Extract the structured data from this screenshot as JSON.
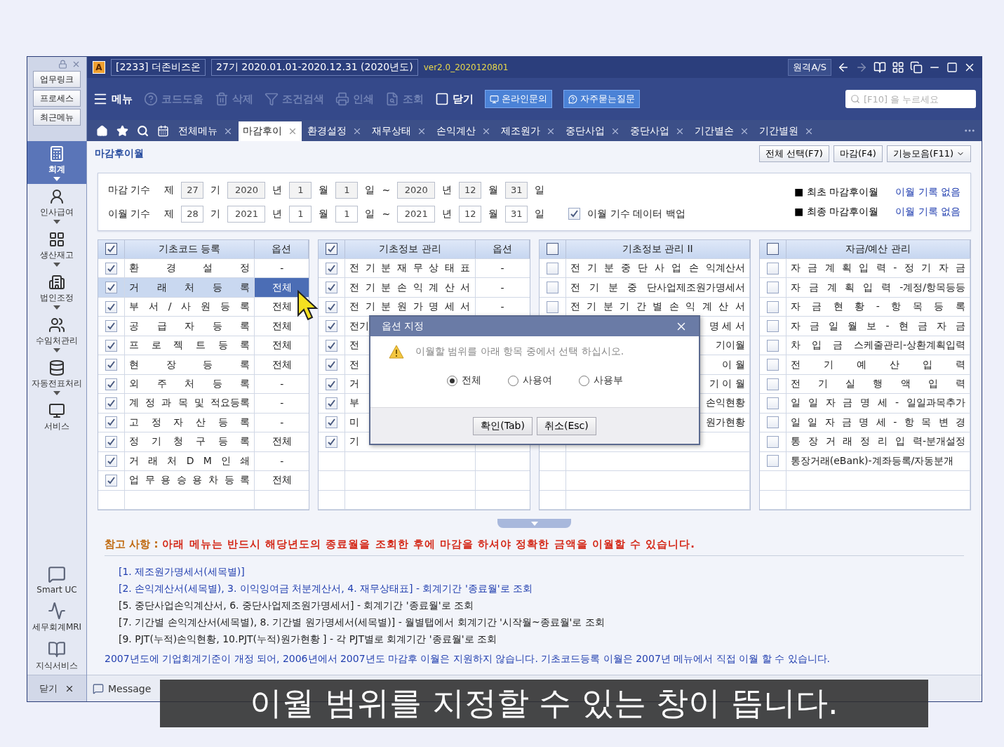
{
  "title_bar": {
    "logo": "A",
    "company": "[2233] 더존비즈온",
    "period": "27기 2020.01.01-2020.12.31 (2020년도)",
    "version": "ver2.0_2020120801",
    "remote": "원격A/S"
  },
  "sidebar": {
    "links": [
      "업무링크",
      "프로세스",
      "최근메뉴"
    ],
    "modules": [
      {
        "label": "회계",
        "selected": true,
        "expandable": true
      },
      {
        "label": "인사급여",
        "selected": false,
        "expandable": true
      },
      {
        "label": "생산재고",
        "selected": false,
        "expandable": true
      },
      {
        "label": "법인조정",
        "selected": false,
        "expandable": true
      },
      {
        "label": "수임처관리",
        "selected": false,
        "expandable": true
      },
      {
        "label": "자동전표처리",
        "selected": false,
        "expandable": true
      },
      {
        "label": "서비스",
        "selected": false,
        "expandable": false
      }
    ],
    "services": [
      "Smart UC",
      "세무회계MRI",
      "지식서비스"
    ],
    "close": "닫기"
  },
  "toolbar": {
    "menu": "메뉴",
    "actions": [
      {
        "label": "코드도움",
        "disabled": true
      },
      {
        "label": "삭제",
        "disabled": true
      },
      {
        "label": "조건검색",
        "disabled": true
      },
      {
        "label": "인쇄",
        "disabled": true
      },
      {
        "label": "조회",
        "disabled": true
      },
      {
        "label": "닫기",
        "disabled": false
      }
    ],
    "help": [
      "온라인문의",
      "자주묻는질문"
    ],
    "search": {
      "placeholder": "[F10] 을 누르세요"
    }
  },
  "tabs": [
    {
      "label": "전체메뉴",
      "selected": false
    },
    {
      "label": "마감후이",
      "selected": true
    },
    {
      "label": "환경설정",
      "selected": false
    },
    {
      "label": "재무상태",
      "selected": false
    },
    {
      "label": "손익계산",
      "selected": false
    },
    {
      "label": "제조원가",
      "selected": false
    },
    {
      "label": "중단사업",
      "selected": false
    },
    {
      "label": "중단사업",
      "selected": false
    },
    {
      "label": "기간별손",
      "selected": false
    },
    {
      "label": "기간별원",
      "selected": false
    }
  ],
  "page": {
    "title": "마감후이월",
    "buttons": [
      {
        "label": "전체 선택(F7)",
        "dropdown": false
      },
      {
        "label": "마감(F4)",
        "dropdown": false
      },
      {
        "label": "기능모음(F11)",
        "dropdown": true
      }
    ]
  },
  "form": {
    "rows": [
      {
        "label": "마감 기수",
        "disabled": true,
        "parts": [
          {
            "kind": "text",
            "text": "제"
          },
          {
            "kind": "field",
            "value": "27"
          },
          {
            "kind": "text",
            "text": "기"
          },
          {
            "kind": "field",
            "value": "2020",
            "wide": true
          },
          {
            "kind": "text",
            "text": "년"
          },
          {
            "kind": "field",
            "value": "1"
          },
          {
            "kind": "text",
            "text": "월"
          },
          {
            "kind": "field",
            "value": "1"
          },
          {
            "kind": "text",
            "text": "일"
          },
          {
            "kind": "text",
            "text": "~"
          },
          {
            "kind": "field",
            "value": "2020",
            "wide": true
          },
          {
            "kind": "text",
            "text": "년"
          },
          {
            "kind": "field",
            "value": "12"
          },
          {
            "kind": "text",
            "text": "월"
          },
          {
            "kind": "field",
            "value": "31"
          },
          {
            "kind": "text",
            "text": "일"
          }
        ]
      },
      {
        "label": "이월 기수",
        "disabled": false,
        "parts": [
          {
            "kind": "text",
            "text": "제"
          },
          {
            "kind": "field",
            "value": "28"
          },
          {
            "kind": "text",
            "text": "기"
          },
          {
            "kind": "field",
            "value": "2021",
            "wide": true
          },
          {
            "kind": "text",
            "text": "년"
          },
          {
            "kind": "field",
            "value": "1"
          },
          {
            "kind": "text",
            "text": "월"
          },
          {
            "kind": "field",
            "value": "1"
          },
          {
            "kind": "text",
            "text": "일"
          },
          {
            "kind": "text",
            "text": "~"
          },
          {
            "kind": "field",
            "value": "2021",
            "wide": true
          },
          {
            "kind": "text",
            "text": "년"
          },
          {
            "kind": "field",
            "value": "12"
          },
          {
            "kind": "text",
            "text": "월"
          },
          {
            "kind": "field",
            "value": "31"
          },
          {
            "kind": "text",
            "text": "일"
          }
        ],
        "backup": {
          "label": "이월 기수 데이터 백업",
          "checked": true
        }
      }
    ],
    "history": [
      {
        "label": "■ 최초 마감후이월",
        "value": "이월 기록 없음"
      },
      {
        "label": "■ 최종 마감후이월",
        "value": "이월 기록 없음"
      }
    ]
  },
  "tables": [
    {
      "title": "기초코드 등록",
      "option_title": "옵션",
      "checked": true,
      "rows": [
        {
          "kind": "full",
          "checked": true,
          "selected": false,
          "text": "환 경 설 정",
          "option": "-"
        },
        {
          "kind": "full",
          "checked": true,
          "selected": true,
          "text": "거 래 처 등 록",
          "option": "전체"
        },
        {
          "kind": "full",
          "checked": true,
          "selected": false,
          "text": "부 서 / 사 원 등 록",
          "option": "전체"
        },
        {
          "kind": "full",
          "checked": true,
          "selected": false,
          "text": "공 급 자 등 록",
          "option": "전체"
        },
        {
          "kind": "full",
          "checked": true,
          "selected": false,
          "text": "프 로 젝 트 등 록",
          "option": "전체"
        },
        {
          "kind": "full",
          "checked": true,
          "selected": false,
          "text": "현 장 등 록",
          "option": "전체"
        },
        {
          "kind": "full",
          "checked": true,
          "selected": false,
          "text": "외 주 처 등 록",
          "option": "-"
        },
        {
          "kind": "full",
          "checked": true,
          "selected": false,
          "text": "계 정 과 목 및 적요등록",
          "option": "-"
        },
        {
          "kind": "full",
          "checked": true,
          "selected": false,
          "text": "고 정 자 산 등 록",
          "option": "-"
        },
        {
          "kind": "full",
          "checked": true,
          "selected": false,
          "text": "정 기 청 구 등 록",
          "option": "전체"
        },
        {
          "kind": "full",
          "checked": true,
          "selected": false,
          "text": "거 래 처 D M 인 쇄",
          "option": "-"
        },
        {
          "kind": "full",
          "checked": true,
          "selected": false,
          "text": "업 무 용 승 용 차 등 록",
          "option": "전체"
        }
      ]
    },
    {
      "title": "기초정보 관리",
      "option_title": "옵션",
      "checked": true,
      "rows": [
        {
          "kind": "full",
          "checked": true,
          "selected": false,
          "text": "전 기 분 재 무 상 태 표",
          "option": "-"
        },
        {
          "kind": "full",
          "checked": true,
          "selected": false,
          "text": "전 기 분 손 익 계 산 서",
          "option": "-"
        },
        {
          "kind": "full",
          "checked": true,
          "selected": false,
          "text": "전 기 분 원 가 명 세 서",
          "option": "-"
        },
        {
          "kind": "head",
          "checked": true,
          "selected": false,
          "text": "전기"
        },
        {
          "kind": "head",
          "checked": true,
          "selected": false,
          "text": "전"
        },
        {
          "kind": "head",
          "checked": true,
          "selected": false,
          "text": "전"
        },
        {
          "kind": "head",
          "checked": true,
          "selected": false,
          "text": "거"
        },
        {
          "kind": "head",
          "checked": true,
          "selected": false,
          "text": "부"
        },
        {
          "kind": "head",
          "checked": true,
          "selected": false,
          "text": "미"
        },
        {
          "kind": "head",
          "checked": true,
          "selected": false,
          "text": "기"
        }
      ]
    },
    {
      "title": "기초정보 관리 II",
      "checked": false,
      "rows": [
        {
          "kind": "full",
          "checked": false,
          "selected": false,
          "text": "전 기 분 중 단 사 업 손 익계산서"
        },
        {
          "kind": "full",
          "checked": false,
          "selected": false,
          "text": "전 기 분 중 단사업제조원가명세서"
        },
        {
          "kind": "full",
          "checked": false,
          "selected": false,
          "text": "전 기 분 기 간 별 손 익 계 산 서"
        },
        {
          "kind": "tail",
          "selected": false,
          "text": "명 세 서"
        },
        {
          "kind": "tail",
          "selected": false,
          "text": "기이월"
        },
        {
          "kind": "tail",
          "selected": false,
          "text": "이 월"
        },
        {
          "kind": "tail",
          "selected": false,
          "text": "기 이 월"
        },
        {
          "kind": "tail",
          "selected": false,
          "text": "손익현황"
        },
        {
          "kind": "tail",
          "selected": false,
          "text": "원가현황"
        }
      ]
    },
    {
      "title": "자금/예산 관리",
      "checked": false,
      "rows": [
        {
          "kind": "full",
          "checked": false,
          "selected": false,
          "text": "자 금 계 획 입 력 - 정 기 자 금"
        },
        {
          "kind": "full",
          "checked": false,
          "selected": false,
          "text": "자 금 계 획 입 력 -계정/항목등등"
        },
        {
          "kind": "full",
          "checked": false,
          "selected": false,
          "text": "자 금 현 황 - 항 목 등 록"
        },
        {
          "kind": "full",
          "checked": false,
          "selected": false,
          "text": "자 금 일 월 보 - 현 금 자 금"
        },
        {
          "kind": "full",
          "checked": false,
          "selected": false,
          "text": "차 입 금 스케줄관리-상환계획입력"
        },
        {
          "kind": "full",
          "checked": false,
          "selected": false,
          "text": "전 기 예 산 입 력"
        },
        {
          "kind": "full",
          "checked": false,
          "selected": false,
          "text": "전 기 실 행 액 입 력"
        },
        {
          "kind": "full",
          "checked": false,
          "selected": false,
          "text": "일 일 자 금 명 세 - 일일과목추가"
        },
        {
          "kind": "full",
          "checked": false,
          "selected": false,
          "text": "일 일 자 금 명 세 - 항 목 변 경"
        },
        {
          "kind": "full",
          "checked": false,
          "selected": false,
          "text": "통 장 거 래 정 리 입 력-분개설정"
        },
        {
          "kind": "full",
          "checked": false,
          "selected": false,
          "text": "통장거래(eBank)-계좌등록/자동분개"
        }
      ]
    }
  ],
  "dialog": {
    "title": "옵션 지정",
    "message": "이월할 범위를 아래 항목 중에서 선택 하십시오.",
    "options": [
      {
        "label": "전체",
        "selected": true
      },
      {
        "label": "사용여",
        "selected": false
      },
      {
        "label": "사용부",
        "selected": false
      }
    ],
    "buttons": [
      "확인(Tab)",
      "취소(Esc)"
    ]
  },
  "notes": {
    "label": "참고 사항 :",
    "warning": "아래 메뉴는 반드시 해당년도의 종료월을 조회한 후에 마감을 하셔야 정확한 금액을 이월할 수 있습니다.",
    "lines": [
      {
        "text": "[1. 제조원가명세서(세목별)]",
        "color": "#2340b0"
      },
      {
        "text": "[2. 손익계산서(세목별), 3. 이익잉여금 처분계산서, 4. 재무상태표] - 회계기간 '종료월'로 조회",
        "color": "#2340b0"
      },
      {
        "text": "[5. 중단사업손익계산서, 6. 중단사업제조원가명세서] - 회계기간 '종료월'로 조회",
        "color": "#222222"
      },
      {
        "text": "[7. 기간별 손익계산서(세목별), 8. 기간별 원가명세서(세목별)] - 월별탭에서 회계기간 '시작월~종료월'로 조회",
        "color": "#222222"
      },
      {
        "text": "[9. PJT(누적)손익현황, 10.PJT(누적)원가현황 ] - 각 PJT별로 회계기간 '종료월'로 조회",
        "color": "#222222"
      }
    ],
    "footer": "2007년도에 기업회계기준이 개정 되어, 2006년에서 2007년도 마감후 이월은 지원하지 않습니다. 기초코드등록 이월은 2007년 메뉴에서 직접 이월 할 수 있습니다."
  },
  "status_bar": {
    "message": "Message"
  },
  "caption": "이월 범위를 지정할 수 있는 창이 뜹니다."
}
